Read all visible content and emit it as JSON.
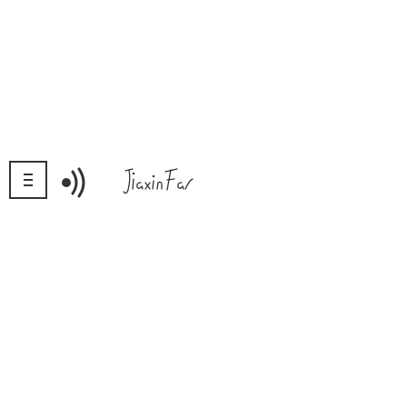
{
  "toolbar": {
    "menu_icon": "hamburger-menu-icon",
    "audio_icon": "speaker-sound-waves-icon",
    "logo": {
      "text": "Jiaxin Fa",
      "kind": "handwritten-logo"
    }
  },
  "colors": {
    "background": "#ffffff",
    "icon": "#333333"
  }
}
